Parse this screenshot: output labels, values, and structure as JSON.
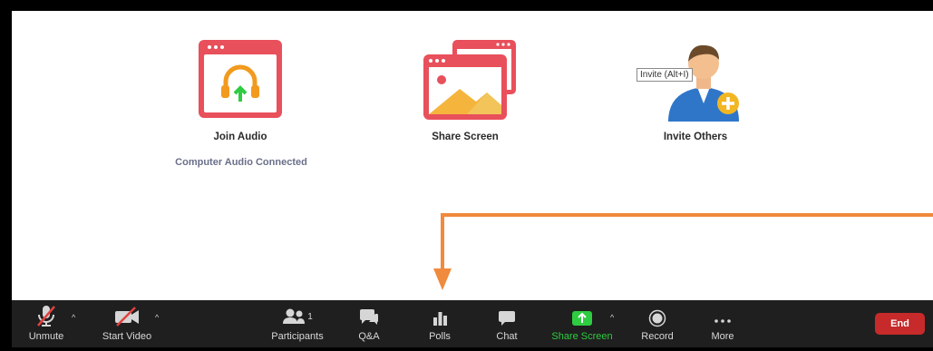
{
  "stage": {
    "join_audio": {
      "label": "Join Audio",
      "status": "Computer Audio Connected"
    },
    "share_screen": {
      "label": "Share Screen"
    },
    "invite_others": {
      "label": "Invite Others",
      "tooltip": "Invite (Alt+I)"
    }
  },
  "toolbar": {
    "unmute": "Unmute",
    "start_video": "Start Video",
    "participants": "Participants",
    "participants_count": "1",
    "qa": "Q&A",
    "polls": "Polls",
    "chat": "Chat",
    "share_screen": "Share Screen",
    "record": "Record",
    "more": "More",
    "end": "End"
  },
  "colors": {
    "toolbar_bg": "#1f1f1f",
    "share_green": "#2ecc40",
    "end_red": "#c72a2a",
    "annotation_orange": "#f08a3c",
    "card_red": "#e8505b"
  }
}
